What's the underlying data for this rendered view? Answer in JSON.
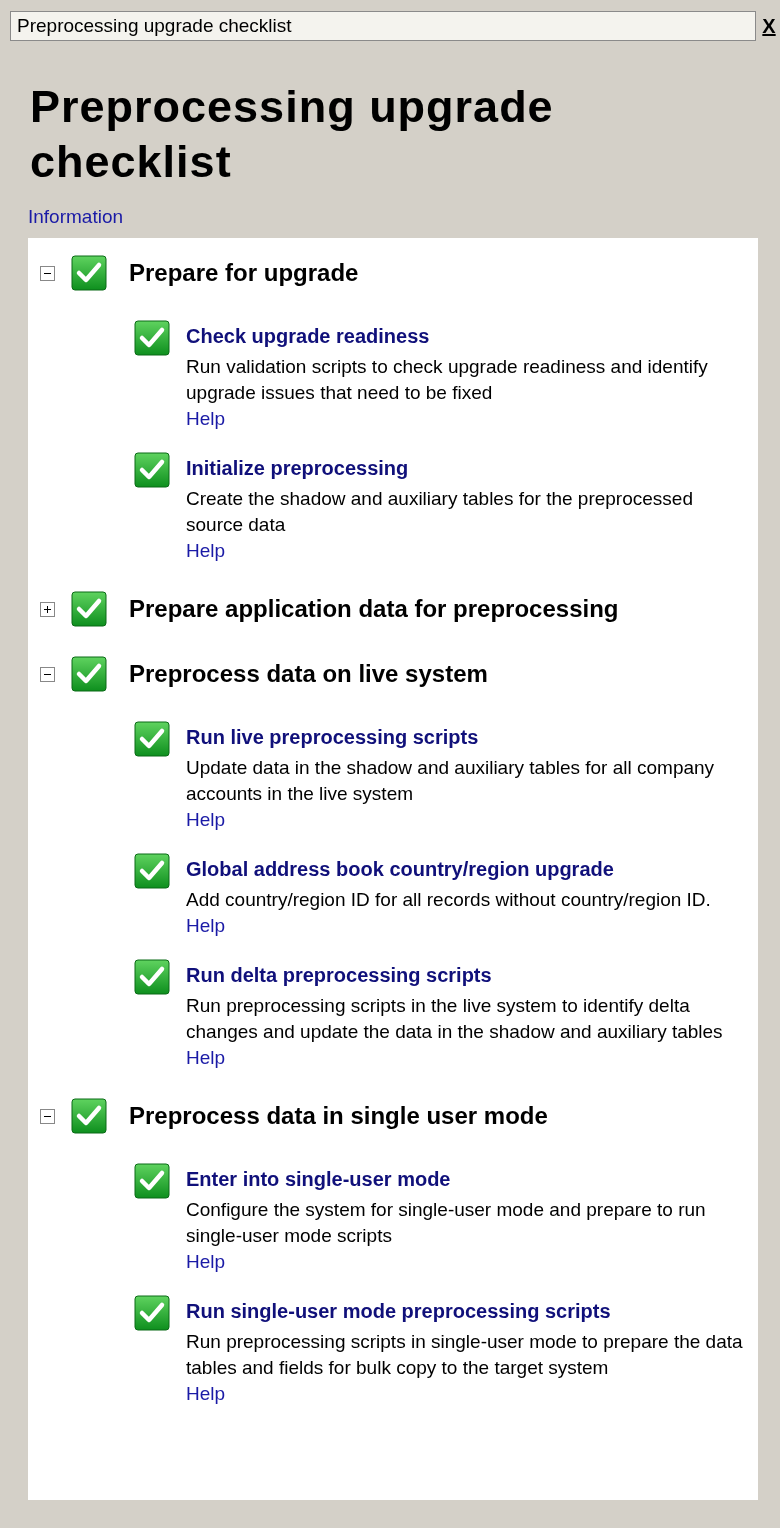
{
  "window": {
    "title": "Preprocessing upgrade checklist",
    "close": "X"
  },
  "heading": "Preprocessing upgrade checklist",
  "info_link": "Information",
  "groups": [
    {
      "title": "Prepare for upgrade",
      "expanded": true,
      "completed": true,
      "tasks": [
        {
          "title": "Check upgrade readiness",
          "description": "Run validation scripts to check upgrade readiness and identify upgrade issues that need to be fixed",
          "help": "Help",
          "completed": true
        },
        {
          "title": "Initialize preprocessing",
          "description": "Create the shadow and auxiliary tables for the preprocessed source data",
          "help": "Help",
          "completed": true
        }
      ]
    },
    {
      "title": "Prepare application data for preprocessing",
      "expanded": false,
      "completed": true
    },
    {
      "title": "Preprocess data on live system",
      "expanded": true,
      "completed": true,
      "tasks": [
        {
          "title": "Run live preprocessing scripts",
          "description": "Update data in the shadow and auxiliary tables for all company accounts in the live system",
          "help": "Help",
          "completed": true
        },
        {
          "title": "Global address book country/region upgrade",
          "description": "Add country/region ID for all records without country/region ID.",
          "help": "Help",
          "completed": true
        },
        {
          "title": "Run delta preprocessing scripts",
          "description": "Run preprocessing scripts in the live system to identify delta changes and update the data in the shadow and auxiliary tables",
          "help": "Help",
          "completed": true
        }
      ]
    },
    {
      "title": "Preprocess data in single user mode",
      "expanded": true,
      "completed": true,
      "tasks": [
        {
          "title": "Enter into single-user mode",
          "description": "Configure the system for single-user mode and prepare to run single-user mode scripts",
          "help": "Help",
          "completed": true
        },
        {
          "title": "Run single-user mode preprocessing scripts",
          "description": "Run preprocessing scripts in single-user mode to prepare the data tables and fields for bulk copy to the target system",
          "help": "Help",
          "completed": true
        }
      ]
    }
  ]
}
